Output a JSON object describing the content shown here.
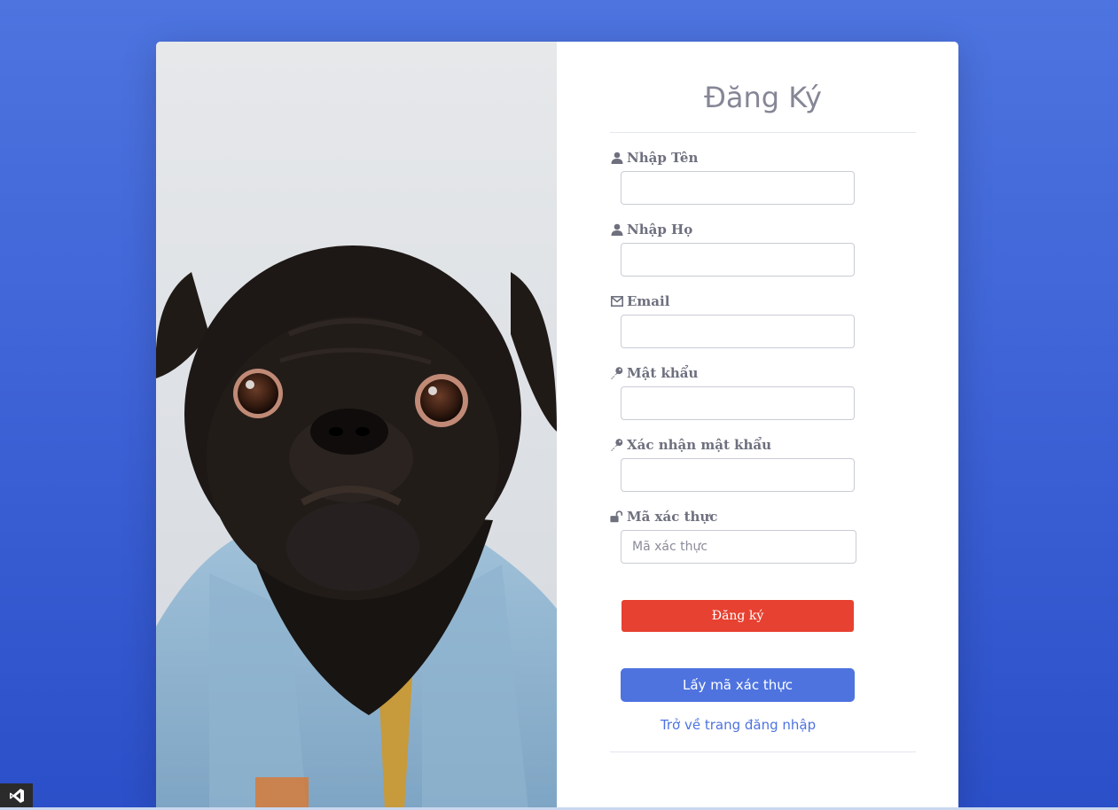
{
  "page": {
    "background_color": "#4e73df"
  },
  "image": {
    "description_icon": "pug-in-denim-jacket-photo"
  },
  "form": {
    "title": "Đăng Ký",
    "fields": [
      {
        "label": "Nhập Tên",
        "icon": "user-icon",
        "value": "",
        "placeholder": ""
      },
      {
        "label": "Nhập Họ",
        "icon": "user-icon",
        "value": "",
        "placeholder": ""
      },
      {
        "label": "Email",
        "icon": "envelope-icon",
        "value": "",
        "placeholder": ""
      },
      {
        "label": "Mật khẩu",
        "icon": "key-icon",
        "value": "",
        "placeholder": ""
      },
      {
        "label": "Xác nhận mật khẩu",
        "icon": "key-icon",
        "value": "",
        "placeholder": ""
      },
      {
        "label": "Mã xác thực",
        "icon": "unlock-icon",
        "value": "",
        "placeholder": "Mã xác thực"
      }
    ],
    "register_button": "Đăng ký",
    "get_code_button": "Lấy mã xác thực",
    "back_link": "Trở về trang đăng nhập"
  },
  "colors": {
    "primary": "#4e73df",
    "danger": "#e74131",
    "label_text": "#6e707e",
    "title_text": "#858796"
  },
  "taskbar": {
    "icon": "visual-studio-icon"
  }
}
